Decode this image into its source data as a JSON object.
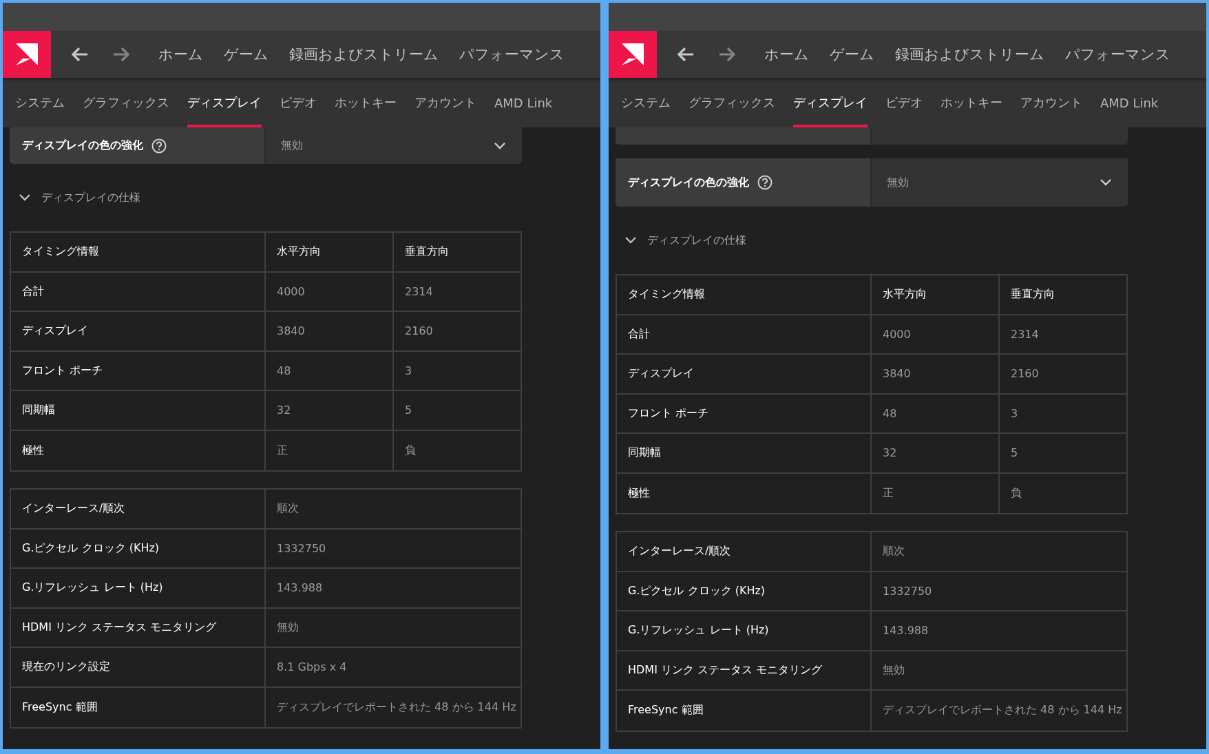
{
  "panels": [
    {
      "nav": {
        "buttons": [
          {
            "kind": "back",
            "disabled": false
          },
          {
            "kind": "forward",
            "disabled": true
          }
        ],
        "items": [
          "ホーム",
          "ゲーム",
          "録画およびストリーム",
          "パフォーマンス"
        ]
      },
      "tabs": [
        {
          "label": "システム",
          "selected": false
        },
        {
          "label": "グラフィックス",
          "selected": false
        },
        {
          "label": "ディスプレイ",
          "selected": true
        },
        {
          "label": "ビデオ",
          "selected": false
        },
        {
          "label": "ホットキー",
          "selected": false
        },
        {
          "label": "アカウント",
          "selected": false
        },
        {
          "label": "AMD Link",
          "selected": false
        }
      ],
      "partial_card_above": false,
      "setting_clipped": true,
      "setting": {
        "label": "ディスプレイの色の強化",
        "value": "無効"
      },
      "specs": {
        "heading": "ディスプレイの仕様",
        "expanded": true,
        "timing_table": {
          "columns": [
            "タイミング情報",
            "水平方向",
            "垂直方向"
          ],
          "rows": [
            [
              "合計",
              "4000",
              "2314"
            ],
            [
              "ディスプレイ",
              "3840",
              "2160"
            ],
            [
              "フロント ポーチ",
              "48",
              "3"
            ],
            [
              "同期幅",
              "32",
              "5"
            ],
            [
              "極性",
              "正",
              "負"
            ]
          ]
        },
        "info_table": {
          "rows": [
            [
              "インターレース/順次",
              "順次"
            ],
            [
              "G.ピクセル クロック (KHz)",
              "1332750"
            ],
            [
              "G.リフレッシュ レート (Hz)",
              "143.988"
            ],
            [
              "HDMI リンク ステータス モニタリング",
              "無効"
            ],
            [
              "現在のリンク設定",
              "8.1 Gbps x 4"
            ],
            [
              "FreeSync 範囲",
              "ディスプレイでレポートされた 48 から 144 Hz"
            ]
          ]
        }
      }
    },
    {
      "nav": {
        "buttons": [
          {
            "kind": "back",
            "disabled": false
          },
          {
            "kind": "forward",
            "disabled": true
          }
        ],
        "items": [
          "ホーム",
          "ゲーム",
          "録画およびストリーム",
          "パフォーマンス"
        ]
      },
      "tabs": [
        {
          "label": "システム",
          "selected": false
        },
        {
          "label": "グラフィックス",
          "selected": false
        },
        {
          "label": "ディスプレイ",
          "selected": true
        },
        {
          "label": "ビデオ",
          "selected": false
        },
        {
          "label": "ホットキー",
          "selected": false
        },
        {
          "label": "アカウント",
          "selected": false
        },
        {
          "label": "AMD Link",
          "selected": false
        }
      ],
      "partial_card_above": true,
      "setting_clipped": false,
      "setting": {
        "label": "ディスプレイの色の強化",
        "value": "無効"
      },
      "specs": {
        "heading": "ディスプレイの仕様",
        "expanded": true,
        "timing_table": {
          "columns": [
            "タイミング情報",
            "水平方向",
            "垂直方向"
          ],
          "rows": [
            [
              "合計",
              "4000",
              "2314"
            ],
            [
              "ディスプレイ",
              "3840",
              "2160"
            ],
            [
              "フロント ポーチ",
              "48",
              "3"
            ],
            [
              "同期幅",
              "32",
              "5"
            ],
            [
              "極性",
              "正",
              "負"
            ]
          ]
        },
        "info_table": {
          "rows": [
            [
              "インターレース/順次",
              "順次"
            ],
            [
              "G.ピクセル クロック (KHz)",
              "1332750"
            ],
            [
              "G.リフレッシュ レート (Hz)",
              "143.988"
            ],
            [
              "HDMI リンク ステータス モニタリング",
              "無効"
            ],
            [
              "FreeSync 範囲",
              "ディスプレイでレポートされた 48 から 144 Hz"
            ]
          ]
        }
      }
    }
  ]
}
